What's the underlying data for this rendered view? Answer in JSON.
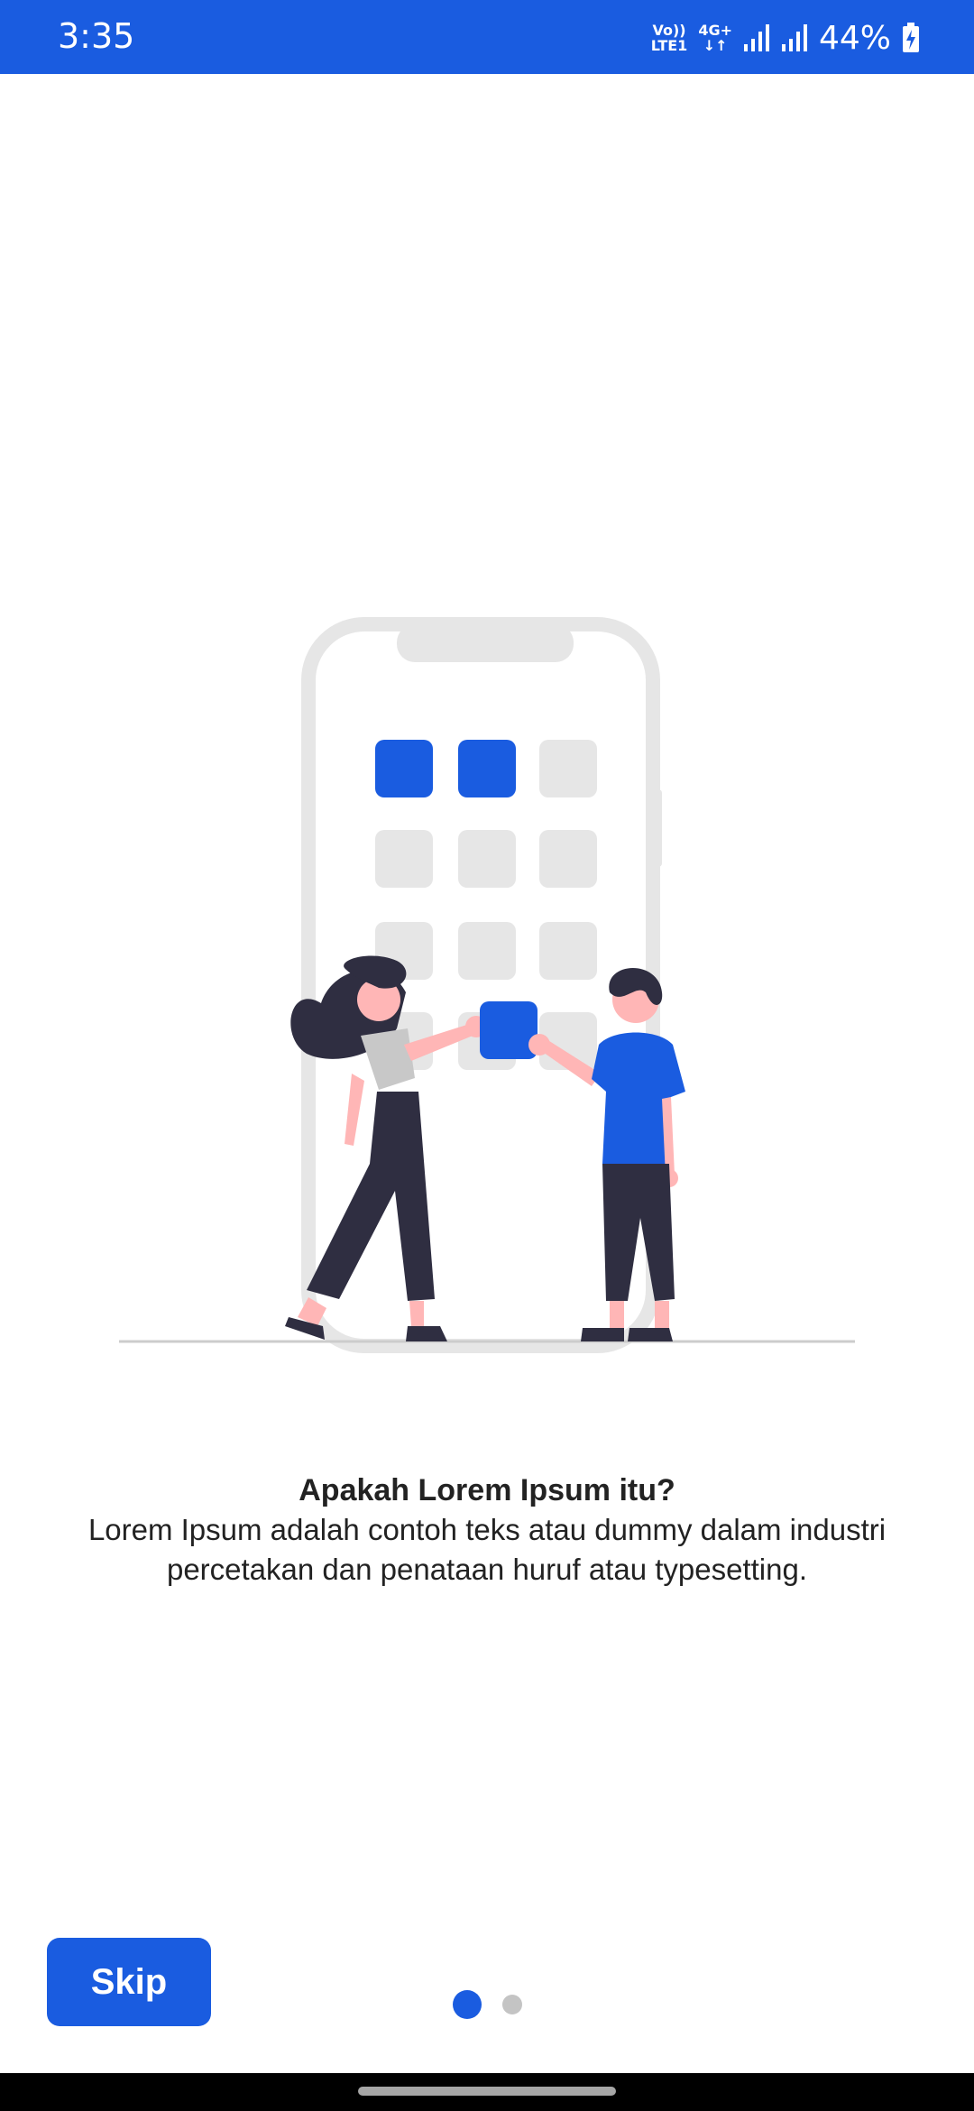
{
  "status_bar": {
    "time": "3:35",
    "network_top": "Vo))",
    "network_bottom": "LTE1",
    "data_type": "4G+",
    "data_arrows": "↓↑",
    "battery_percent": "44%",
    "icons": [
      "volte-icon",
      "data-arrows-icon",
      "signal-icon",
      "signal-icon",
      "battery-charging-icon"
    ]
  },
  "onboarding": {
    "illustration": "people-arranging-app-icons-on-phone",
    "title": "Apakah Lorem Ipsum itu?",
    "description": "Lorem Ipsum adalah contoh teks atau dummy dalam industri percetakan dan penataan huruf atau typesetting."
  },
  "controls": {
    "skip_label": "Skip",
    "page_count": 2,
    "current_page": 1
  },
  "colors": {
    "accent": "#1a5ce0",
    "dot_inactive": "#c4c4c4",
    "text": "#222222",
    "illustration_gray": "#e6e6e6",
    "figure_dark": "#2f2e41",
    "skin": "#ffb6b6"
  }
}
